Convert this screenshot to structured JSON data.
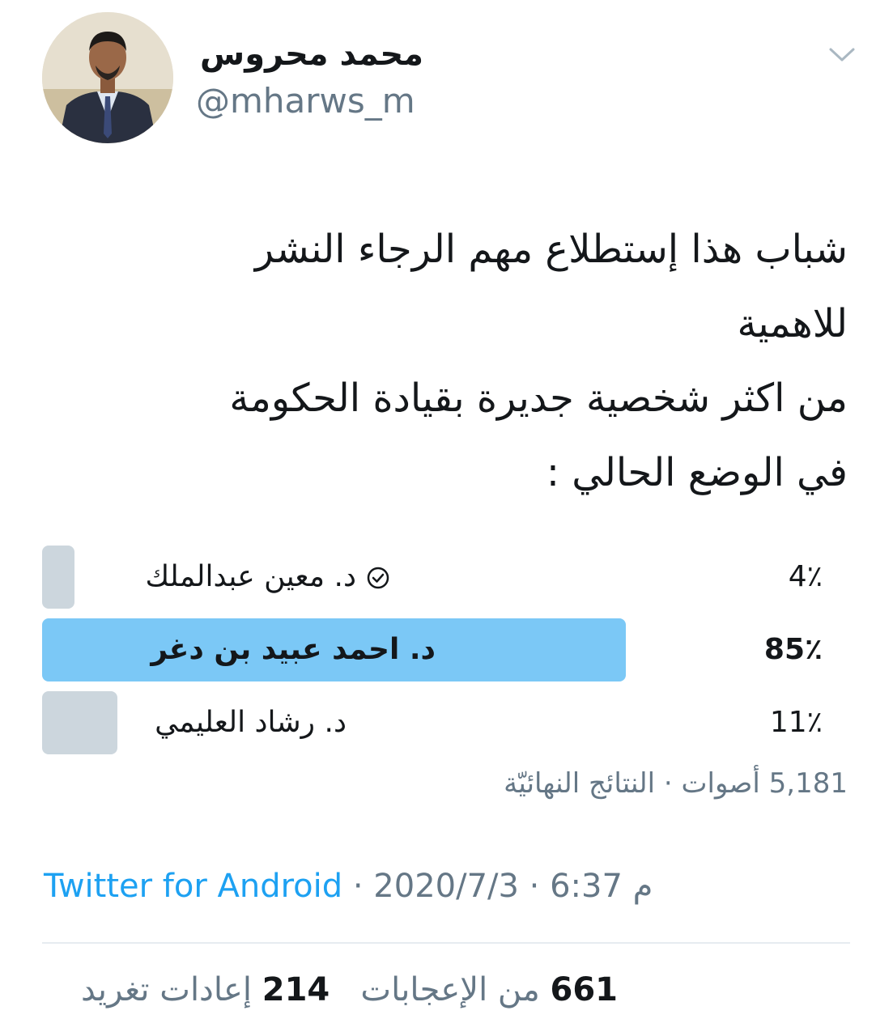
{
  "author": {
    "display_name": "محمد محروس",
    "handle": "@mharws_m"
  },
  "tweet": {
    "text": "شباب هذا إستطلاع مهم الرجاء النشر\nللاهمية\nمن اكثر شخصية جديرة بقيادة الحكومة\nفي الوضع الحالي :"
  },
  "poll": {
    "options": [
      {
        "label": "د. معين عبدالملك",
        "percent_text": "4٪",
        "fraction": 0.04,
        "voted_by_user": true
      },
      {
        "label": "د. احمد عبيد بن دغر",
        "percent_text": "85٪",
        "fraction": 0.85,
        "winner": true
      },
      {
        "label": "د. رشاد العليمي",
        "percent_text": "11٪",
        "fraction": 0.11
      }
    ],
    "votes_count": "5,181",
    "votes_label": "أصوات",
    "separator": "·",
    "status": "النتائج النهائيّة"
  },
  "meta": {
    "source": "Twitter for Android",
    "sep": "·",
    "date": "2020/7/3",
    "time": "6:37",
    "ampm": "م"
  },
  "stats": {
    "retweets_count": "214",
    "retweets_label": "إعادات تغريد",
    "likes_count": "661",
    "likes_label": "من الإعجابات"
  },
  "colors": {
    "accent": "#1da1f2",
    "winner_bar": "#7bc8f6",
    "bar": "#ccd6dd",
    "secondary_text": "#657786"
  },
  "icons": {
    "menu": "chevron-down-icon",
    "voted": "check-circle-icon"
  }
}
